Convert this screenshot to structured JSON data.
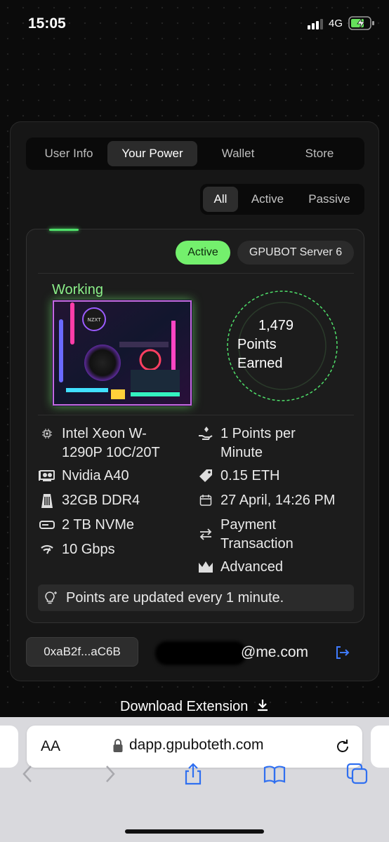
{
  "status_bar": {
    "time": "15:05",
    "network": "4G"
  },
  "tabs": [
    {
      "label": "User Info"
    },
    {
      "label": "Your Power"
    },
    {
      "label": "Wallet"
    },
    {
      "label": "Store"
    }
  ],
  "filters": [
    {
      "label": "All"
    },
    {
      "label": "Active"
    },
    {
      "label": "Passive"
    }
  ],
  "server": {
    "status_badge": "Active",
    "name": "GPUBOT Server 6",
    "state": "Working",
    "points_value": "1,479",
    "points_label_1": "Points",
    "points_label_2": "Earned",
    "specs_left": [
      {
        "icon": "cpu-icon",
        "line1": "Intel Xeon W-",
        "line2": "1290P 10C/20T"
      },
      {
        "icon": "gpu-icon",
        "line1": "Nvidia A40",
        "line2": ""
      },
      {
        "icon": "memory-icon",
        "line1": "32GB DDR4",
        "line2": ""
      },
      {
        "icon": "storage-icon",
        "line1": "2 TB NVMe",
        "line2": ""
      },
      {
        "icon": "network-speed-icon",
        "line1": "10 Gbps",
        "line2": ""
      }
    ],
    "specs_right": [
      {
        "icon": "hand-coin-icon",
        "line1": "1 Points per",
        "line2": "Minute"
      },
      {
        "icon": "price-tag-icon",
        "line1": "0.15 ETH",
        "line2": ""
      },
      {
        "icon": "calendar-icon",
        "line1": "27 April, 14:26 PM",
        "line2": ""
      },
      {
        "icon": "transfer-icon",
        "line1": "Payment",
        "line2": "Transaction"
      },
      {
        "icon": "crown-icon",
        "line1": "Advanced",
        "line2": ""
      }
    ],
    "note": "Points are updated every 1 minute."
  },
  "account": {
    "wallet": "0xaB2f...aC6B",
    "email_suffix": "@me.com"
  },
  "download": {
    "label": "Download Extension"
  },
  "browser": {
    "aa": "AA",
    "url": "dapp.gpuboteth.com"
  },
  "colors": {
    "accent_green": "#74f06d",
    "link_blue": "#3f7bff"
  }
}
